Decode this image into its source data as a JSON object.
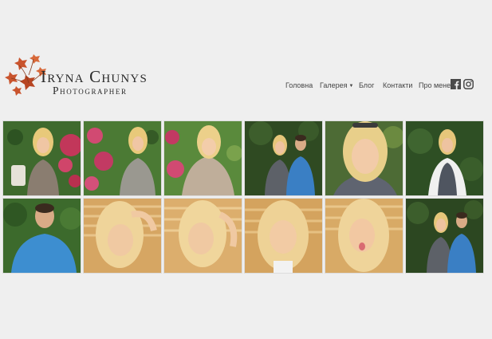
{
  "logo": {
    "title": "Iryna Chunys",
    "subtitle": "Photographer",
    "brand_color": "#c9542d"
  },
  "nav": {
    "items": [
      {
        "label": "Головна"
      },
      {
        "label": "Галерея",
        "has_dropdown": true
      },
      {
        "label": "Блог"
      },
      {
        "label": "Контакти"
      },
      {
        "label": "Про мене"
      }
    ]
  },
  "social": [
    {
      "icon": "facebook-icon"
    },
    {
      "icon": "instagram-icon"
    }
  ],
  "gallery": {
    "rows": [
      [
        {
          "subject": "woman-roses",
          "bg": "#3f6a2e"
        },
        {
          "subject": "woman-roses",
          "bg": "#4b7a34"
        },
        {
          "subject": "woman-roses",
          "bg": "#5a8a3c"
        },
        {
          "subject": "couple",
          "bg": "#2f4a22"
        },
        {
          "subject": "woman-closeup",
          "bg": "#4d6b35"
        },
        {
          "subject": "woman-trees",
          "bg": "#2e4f24"
        }
      ],
      [
        {
          "subject": "man-blue-shirt",
          "bg": "#3c6a2c"
        },
        {
          "subject": "woman-warm",
          "bg": "#d6a663"
        },
        {
          "subject": "woman-warm",
          "bg": "#dcae6d"
        },
        {
          "subject": "woman-warm",
          "bg": "#d4a35e"
        },
        {
          "subject": "woman-warm",
          "bg": "#d8aa66"
        },
        {
          "subject": "couple",
          "bg": "#2c4721"
        }
      ]
    ]
  }
}
